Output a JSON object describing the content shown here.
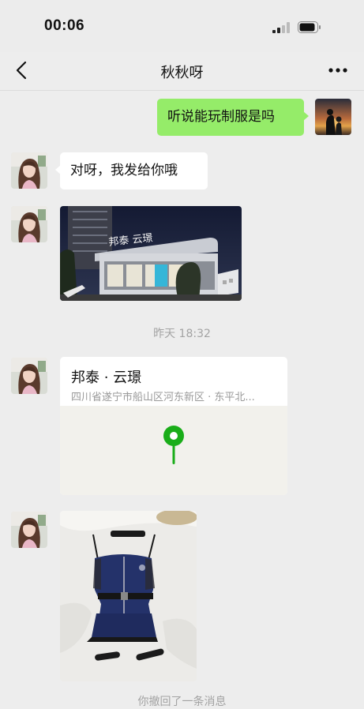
{
  "status_bar": {
    "time": "00:06"
  },
  "header": {
    "title": "秋秋呀"
  },
  "messages": {
    "m1": {
      "text": "听说能玩制服是吗"
    },
    "m2": {
      "text": "对呀，我发给你哦"
    },
    "timestamp": "昨天 18:32",
    "location": {
      "name": "邦泰 · 云璟",
      "address": "四川省遂宁市船山区河东新区 · 东平北..."
    },
    "photo_building_sign": "邦泰 云璟"
  },
  "system": {
    "recall_notice": "你撤回了一条消息"
  },
  "colors": {
    "my_bubble": "#95ec69",
    "other_bubble": "#ffffff",
    "map_pin": "#1aad19",
    "background": "#ededed"
  }
}
